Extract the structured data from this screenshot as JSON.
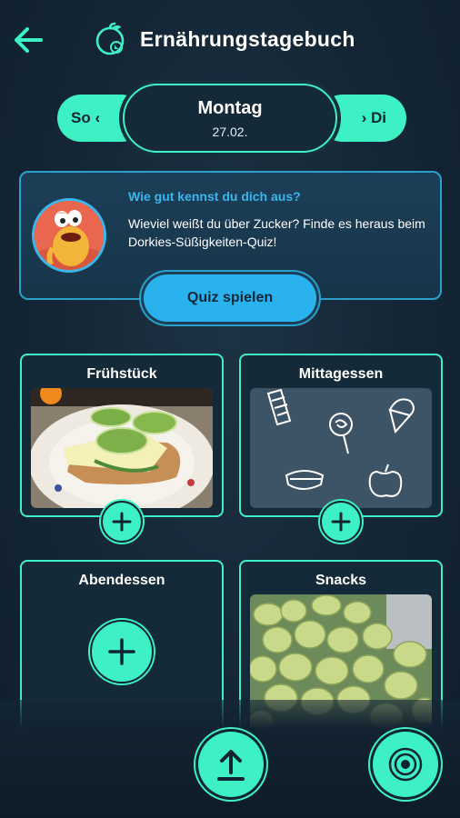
{
  "header": {
    "title": "Ernährungstagebuch",
    "back_icon": "arrow-left-icon",
    "app_icon": "fruit-icon"
  },
  "day_nav": {
    "prev_label": "So ‹",
    "current_day": "Montag",
    "current_date": "27.02.",
    "next_label": "› Di"
  },
  "quiz": {
    "title": "Wie gut kennst du dich aus?",
    "text": "Wieviel weißt du über Zucker? Finde es heraus beim Dorkies-Süßigkeiten-Quiz!",
    "button_label": "Quiz spielen"
  },
  "meals": [
    {
      "label": "Frühstück",
      "content": "photo"
    },
    {
      "label": "Mittagessen",
      "content": "placeholder"
    },
    {
      "label": "Abendessen",
      "content": "empty"
    },
    {
      "label": "Snacks",
      "content": "photo"
    }
  ],
  "bottom": {
    "upload_icon": "upload-icon",
    "target_icon": "target-icon"
  },
  "colors": {
    "accent": "#3ef1c4",
    "quiz_accent": "#2ab2ee",
    "background": "#142636"
  }
}
